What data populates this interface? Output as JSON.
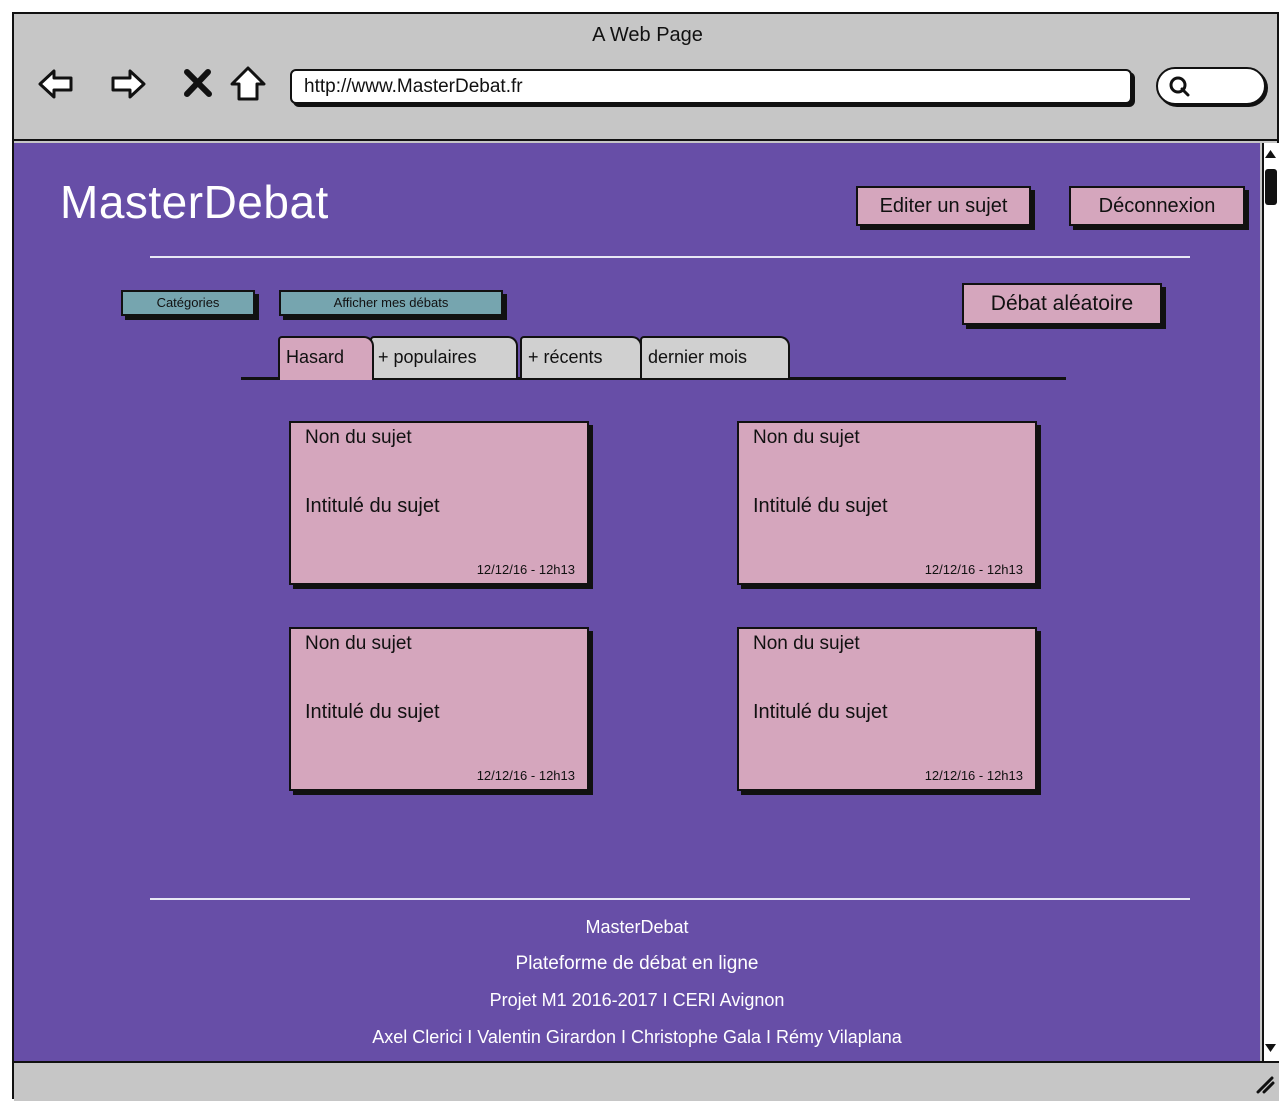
{
  "browser": {
    "window_title": "A Web Page",
    "url": "http://www.MasterDebat.fr"
  },
  "header": {
    "logo": "MasterDebat",
    "edit_label": "Editer un sujet",
    "logout_label": "Déconnexion"
  },
  "toolbar": {
    "categories_label": "Catégories",
    "my_debates_label": "Afficher mes débats",
    "random_label": "Débat aléatoire"
  },
  "tabs": [
    {
      "label": "Hasard",
      "active": true
    },
    {
      "label": "+ populaires",
      "active": false
    },
    {
      "label": "+ récents",
      "active": false
    },
    {
      "label": "dernier mois",
      "active": false
    }
  ],
  "cards": [
    {
      "name": "Non du sujet",
      "title": "Intitulé du sujet",
      "date": "12/12/16 - 12h13"
    },
    {
      "name": "Non du sujet",
      "title": "Intitulé du sujet",
      "date": "12/12/16 - 12h13"
    },
    {
      "name": "Non du sujet",
      "title": "Intitulé du sujet",
      "date": "12/12/16 - 12h13"
    },
    {
      "name": "Non du sujet",
      "title": "Intitulé du sujet",
      "date": "12/12/16 - 12h13"
    }
  ],
  "footer": {
    "line1": "MasterDebat",
    "line2": "Plateforme de débat en ligne",
    "line3": "Projet M1 2016-2017 I CERI Avignon",
    "line4": "Axel Clerici I Valentin Girardon I Christophe Gala I Rémy Vilaplana"
  },
  "colors": {
    "page_background": "#674ea7",
    "card_pink": "#d5a6bd",
    "button_teal": "#76a5af",
    "browser_gray": "#c6c6c6"
  },
  "icons": [
    "back-arrow-icon",
    "forward-arrow-icon",
    "stop-icon",
    "home-icon",
    "search-icon",
    "resize-grip-icon"
  ]
}
